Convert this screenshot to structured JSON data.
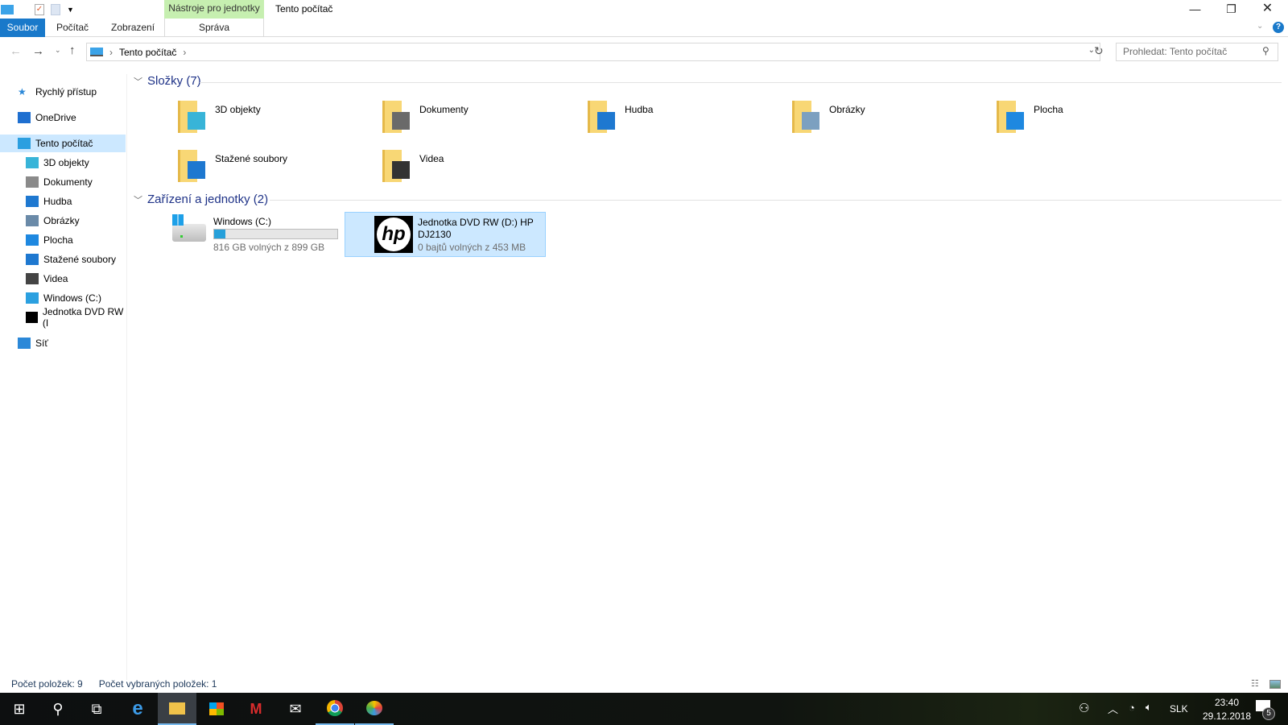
{
  "window": {
    "title": "Tento počítač",
    "context_tab": "Nástroje pro jednotky"
  },
  "ribbon": {
    "tabs": [
      "Soubor",
      "Počítač",
      "Zobrazení"
    ],
    "context_subtab": "Správa"
  },
  "address": {
    "path": [
      "Tento počítač"
    ]
  },
  "search": {
    "placeholder": "Prohledat: Tento počítač"
  },
  "sidebar": {
    "items": [
      {
        "label": "Rychlý přístup",
        "icon": "star-icon",
        "color": "#2b88d8"
      },
      {
        "label": "OneDrive",
        "icon": "cloud-icon",
        "color": "#1e6fd0"
      },
      {
        "label": "Tento počítač",
        "icon": "computer-icon",
        "color": "#2b9fe0",
        "selected": true
      },
      {
        "label": "3D objekty",
        "icon": "cube-icon",
        "color": "#38b4d8"
      },
      {
        "label": "Dokumenty",
        "icon": "document-icon",
        "color": "#8a8a8a"
      },
      {
        "label": "Hudba",
        "icon": "music-icon",
        "color": "#1e78d0"
      },
      {
        "label": "Obrázky",
        "icon": "picture-icon",
        "color": "#6a8aa8"
      },
      {
        "label": "Plocha",
        "icon": "desktop-icon",
        "color": "#1e88e0"
      },
      {
        "label": "Stažené soubory",
        "icon": "download-icon",
        "color": "#1e78d0"
      },
      {
        "label": "Videa",
        "icon": "film-icon",
        "color": "#444"
      },
      {
        "label": "Windows (C:)",
        "icon": "drive-icon",
        "color": "#2ba0e0"
      },
      {
        "label": "Jednotka DVD RW (I",
        "icon": "hp-logo-icon",
        "color": "#000"
      },
      {
        "label": "Síť",
        "icon": "network-icon",
        "color": "#2b88d8"
      }
    ]
  },
  "folders": {
    "header": "Složky (7)",
    "items": [
      {
        "label": "3D objekty",
        "icon": "cube-icon",
        "color": "#38b4d8"
      },
      {
        "label": "Dokumenty",
        "icon": "document-icon",
        "color": "#6a6a6a"
      },
      {
        "label": "Hudba",
        "icon": "music-icon",
        "color": "#1e78d0"
      },
      {
        "label": "Obrázky",
        "icon": "picture-icon",
        "color": "#7ca0c0"
      },
      {
        "label": "Plocha",
        "icon": "desktop-icon",
        "color": "#1e88e0"
      },
      {
        "label": "Stažené soubory",
        "icon": "download-icon",
        "color": "#1e78d0"
      },
      {
        "label": "Videa",
        "icon": "film-icon",
        "color": "#333"
      }
    ]
  },
  "devices": {
    "header": "Zařízení a jednotky (2)",
    "items": [
      {
        "label": "Windows (C:)",
        "free": "816 GB volných z 899 GB",
        "used_fraction": 0.092,
        "icon": "windows-drive-icon"
      },
      {
        "label": "Jednotka DVD RW (D:) HP DJ2130",
        "free": "0 bajtů volných z 453 MB",
        "icon": "hp-logo-icon",
        "selected": true
      }
    ]
  },
  "status": {
    "count": "Počet položek: 9",
    "selected": "Počet vybraných položek: 1"
  },
  "taskbar": {
    "lang": "SLK",
    "time": "23:40",
    "date": "29.12.2018",
    "notifications": "5"
  }
}
